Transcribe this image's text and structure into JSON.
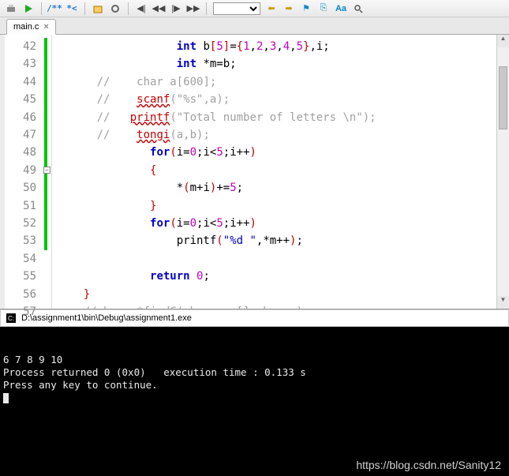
{
  "toolbar": {
    "icons": [
      "print",
      "play",
      "cmt1",
      "cmt2",
      "pkg",
      "settings",
      "left1",
      "left2",
      "right1",
      "right2",
      "sep",
      "nav-back",
      "nav-fwd",
      "a-up",
      "a-dn",
      "Aa",
      "find"
    ]
  },
  "tab": {
    "label": "main.c",
    "close": "×"
  },
  "gutter_start": 42,
  "code_lines": [
    {
      "indent": 3,
      "segs": [
        {
          "t": "int ",
          "c": "kw"
        },
        {
          "t": "b",
          "c": ""
        },
        {
          "t": "[",
          "c": "br"
        },
        {
          "t": "5",
          "c": "num"
        },
        {
          "t": "]",
          "c": "br"
        },
        {
          "t": "=",
          "c": ""
        },
        {
          "t": "{",
          "c": "br"
        },
        {
          "t": "1",
          "c": "num"
        },
        {
          "t": ",",
          "c": ""
        },
        {
          "t": "2",
          "c": "num"
        },
        {
          "t": ",",
          "c": ""
        },
        {
          "t": "3",
          "c": "num"
        },
        {
          "t": ",",
          "c": ""
        },
        {
          "t": "4",
          "c": "num"
        },
        {
          "t": ",",
          "c": ""
        },
        {
          "t": "5",
          "c": "num"
        },
        {
          "t": "}",
          "c": "br"
        },
        {
          "t": ",i;",
          "c": ""
        }
      ]
    },
    {
      "indent": 3,
      "segs": [
        {
          "t": "int ",
          "c": "kw"
        },
        {
          "t": "*m=b;",
          "c": ""
        }
      ]
    },
    {
      "indent": 0,
      "segs": [
        {
          "t": "//    char a[600];",
          "c": "cm"
        }
      ]
    },
    {
      "indent": 0,
      "segs": [
        {
          "t": "//    ",
          "c": "cm"
        },
        {
          "t": "scanf",
          "c": "err"
        },
        {
          "t": "(\"%s\",a);",
          "c": "cm"
        }
      ]
    },
    {
      "indent": 0,
      "segs": [
        {
          "t": "//   ",
          "c": "cm"
        },
        {
          "t": "printf",
          "c": "err"
        },
        {
          "t": "(\"Total number of letters \\n\");",
          "c": "cm"
        }
      ]
    },
    {
      "indent": 0,
      "segs": [
        {
          "t": "//    ",
          "c": "cm"
        },
        {
          "t": "tongi",
          "c": "err"
        },
        {
          "t": "(a,b);",
          "c": "cm"
        }
      ]
    },
    {
      "indent": 2,
      "segs": [
        {
          "t": "for",
          "c": "kw"
        },
        {
          "t": "(",
          "c": "br"
        },
        {
          "t": "i=",
          "c": ""
        },
        {
          "t": "0",
          "c": "num"
        },
        {
          "t": ";i<",
          "c": ""
        },
        {
          "t": "5",
          "c": "num"
        },
        {
          "t": ";i++",
          "c": ""
        },
        {
          "t": ")",
          "c": "br"
        }
      ]
    },
    {
      "indent": 2,
      "segs": [
        {
          "t": "{",
          "c": "br"
        }
      ]
    },
    {
      "indent": 3,
      "segs": [
        {
          "t": "*",
          "c": ""
        },
        {
          "t": "(",
          "c": "br"
        },
        {
          "t": "m+i",
          "c": ""
        },
        {
          "t": ")",
          "c": "br"
        },
        {
          "t": "+=",
          "c": ""
        },
        {
          "t": "5",
          "c": "num"
        },
        {
          "t": ";",
          "c": ""
        }
      ]
    },
    {
      "indent": 2,
      "segs": [
        {
          "t": "}",
          "c": "br"
        }
      ]
    },
    {
      "indent": 2,
      "segs": [
        {
          "t": "for",
          "c": "kw"
        },
        {
          "t": "(",
          "c": "br"
        },
        {
          "t": "i=",
          "c": ""
        },
        {
          "t": "0",
          "c": "num"
        },
        {
          "t": ";i<",
          "c": ""
        },
        {
          "t": "5",
          "c": "num"
        },
        {
          "t": ";i++",
          "c": ""
        },
        {
          "t": ")",
          "c": "br"
        }
      ]
    },
    {
      "indent": 3,
      "segs": [
        {
          "t": "printf",
          "c": "fn"
        },
        {
          "t": "(",
          "c": "br"
        },
        {
          "t": "\"%d \"",
          "c": "str"
        },
        {
          "t": ",*m++",
          "c": ""
        },
        {
          "t": ")",
          "c": "br"
        },
        {
          "t": ";",
          "c": ""
        }
      ]
    },
    {
      "indent": 0,
      "segs": [
        {
          "t": "",
          "c": ""
        }
      ]
    },
    {
      "indent": 2,
      "segs": [
        {
          "t": "return ",
          "c": "kw"
        },
        {
          "t": "0",
          "c": "num"
        },
        {
          "t": ";",
          "c": ""
        }
      ]
    },
    {
      "indent": 0,
      "segs": [
        {
          "t": "}",
          "c": "br"
        }
      ],
      "outdent": true
    },
    {
      "indent": 0,
      "segs": [
        {
          "t": "//char  *findC(char arr[],char c)",
          "c": "cm"
        }
      ],
      "outdent": true
    }
  ],
  "fold_minus_row": 7,
  "console": {
    "title": "D:\\assignment1\\bin\\Debug\\assignment1.exe",
    "lines": [
      "6 7 8 9 10",
      "Process returned 0 (0x0)   execution time : 0.133 s",
      "Press any key to continue."
    ]
  },
  "watermark": "https://blog.csdn.net/Sanity12"
}
